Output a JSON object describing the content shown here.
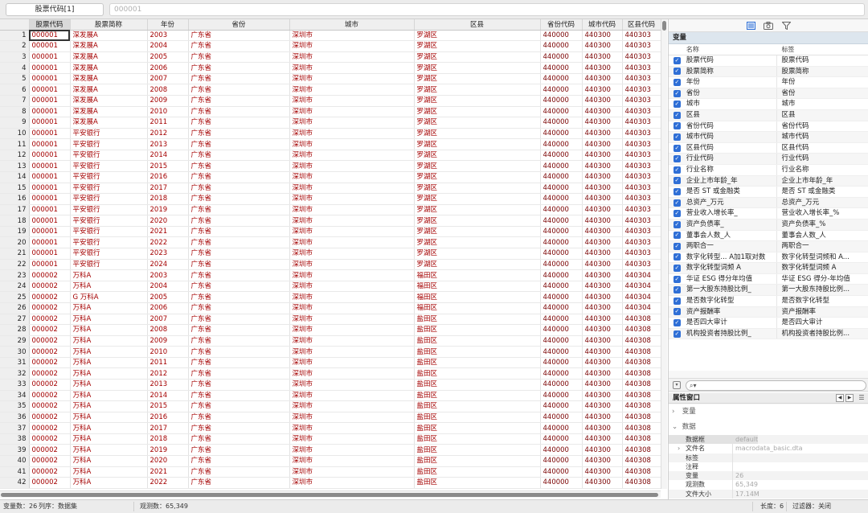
{
  "topbar": {
    "variable_name": "股票代码[1]",
    "cell_value": "000001"
  },
  "grid": {
    "columns": [
      "股票代码",
      "股票简称",
      "年份",
      "省份",
      "城市",
      "区县",
      "省份代码",
      "城市代码",
      "区县代码"
    ],
    "rows": [
      {
        "n": "1",
        "code": "000001",
        "name": "深发展A",
        "year": "2003",
        "prov": "广东省",
        "city": "深圳市",
        "dist": "罗湖区",
        "pc": "440000",
        "cc": "440300",
        "dc": "440303"
      },
      {
        "n": "2",
        "code": "000001",
        "name": "深发展A",
        "year": "2004",
        "prov": "广东省",
        "city": "深圳市",
        "dist": "罗湖区",
        "pc": "440000",
        "cc": "440300",
        "dc": "440303"
      },
      {
        "n": "3",
        "code": "000001",
        "name": "深发展A",
        "year": "2005",
        "prov": "广东省",
        "city": "深圳市",
        "dist": "罗湖区",
        "pc": "440000",
        "cc": "440300",
        "dc": "440303"
      },
      {
        "n": "4",
        "code": "000001",
        "name": "深发展A",
        "year": "2006",
        "prov": "广东省",
        "city": "深圳市",
        "dist": "罗湖区",
        "pc": "440000",
        "cc": "440300",
        "dc": "440303"
      },
      {
        "n": "5",
        "code": "000001",
        "name": "深发展A",
        "year": "2007",
        "prov": "广东省",
        "city": "深圳市",
        "dist": "罗湖区",
        "pc": "440000",
        "cc": "440300",
        "dc": "440303"
      },
      {
        "n": "6",
        "code": "000001",
        "name": "深发展A",
        "year": "2008",
        "prov": "广东省",
        "city": "深圳市",
        "dist": "罗湖区",
        "pc": "440000",
        "cc": "440300",
        "dc": "440303"
      },
      {
        "n": "7",
        "code": "000001",
        "name": "深发展A",
        "year": "2009",
        "prov": "广东省",
        "city": "深圳市",
        "dist": "罗湖区",
        "pc": "440000",
        "cc": "440300",
        "dc": "440303"
      },
      {
        "n": "8",
        "code": "000001",
        "name": "深发展A",
        "year": "2010",
        "prov": "广东省",
        "city": "深圳市",
        "dist": "罗湖区",
        "pc": "440000",
        "cc": "440300",
        "dc": "440303"
      },
      {
        "n": "9",
        "code": "000001",
        "name": "深发展A",
        "year": "2011",
        "prov": "广东省",
        "city": "深圳市",
        "dist": "罗湖区",
        "pc": "440000",
        "cc": "440300",
        "dc": "440303"
      },
      {
        "n": "10",
        "code": "000001",
        "name": "平安银行",
        "year": "2012",
        "prov": "广东省",
        "city": "深圳市",
        "dist": "罗湖区",
        "pc": "440000",
        "cc": "440300",
        "dc": "440303"
      },
      {
        "n": "11",
        "code": "000001",
        "name": "平安银行",
        "year": "2013",
        "prov": "广东省",
        "city": "深圳市",
        "dist": "罗湖区",
        "pc": "440000",
        "cc": "440300",
        "dc": "440303"
      },
      {
        "n": "12",
        "code": "000001",
        "name": "平安银行",
        "year": "2014",
        "prov": "广东省",
        "city": "深圳市",
        "dist": "罗湖区",
        "pc": "440000",
        "cc": "440300",
        "dc": "440303"
      },
      {
        "n": "13",
        "code": "000001",
        "name": "平安银行",
        "year": "2015",
        "prov": "广东省",
        "city": "深圳市",
        "dist": "罗湖区",
        "pc": "440000",
        "cc": "440300",
        "dc": "440303"
      },
      {
        "n": "14",
        "code": "000001",
        "name": "平安银行",
        "year": "2016",
        "prov": "广东省",
        "city": "深圳市",
        "dist": "罗湖区",
        "pc": "440000",
        "cc": "440300",
        "dc": "440303"
      },
      {
        "n": "15",
        "code": "000001",
        "name": "平安银行",
        "year": "2017",
        "prov": "广东省",
        "city": "深圳市",
        "dist": "罗湖区",
        "pc": "440000",
        "cc": "440300",
        "dc": "440303"
      },
      {
        "n": "16",
        "code": "000001",
        "name": "平安银行",
        "year": "2018",
        "prov": "广东省",
        "city": "深圳市",
        "dist": "罗湖区",
        "pc": "440000",
        "cc": "440300",
        "dc": "440303"
      },
      {
        "n": "17",
        "code": "000001",
        "name": "平安银行",
        "year": "2019",
        "prov": "广东省",
        "city": "深圳市",
        "dist": "罗湖区",
        "pc": "440000",
        "cc": "440300",
        "dc": "440303"
      },
      {
        "n": "18",
        "code": "000001",
        "name": "平安银行",
        "year": "2020",
        "prov": "广东省",
        "city": "深圳市",
        "dist": "罗湖区",
        "pc": "440000",
        "cc": "440300",
        "dc": "440303"
      },
      {
        "n": "19",
        "code": "000001",
        "name": "平安银行",
        "year": "2021",
        "prov": "广东省",
        "city": "深圳市",
        "dist": "罗湖区",
        "pc": "440000",
        "cc": "440300",
        "dc": "440303"
      },
      {
        "n": "20",
        "code": "000001",
        "name": "平安银行",
        "year": "2022",
        "prov": "广东省",
        "city": "深圳市",
        "dist": "罗湖区",
        "pc": "440000",
        "cc": "440300",
        "dc": "440303"
      },
      {
        "n": "21",
        "code": "000001",
        "name": "平安银行",
        "year": "2023",
        "prov": "广东省",
        "city": "深圳市",
        "dist": "罗湖区",
        "pc": "440000",
        "cc": "440300",
        "dc": "440303"
      },
      {
        "n": "22",
        "code": "000001",
        "name": "平安银行",
        "year": "2024",
        "prov": "广东省",
        "city": "深圳市",
        "dist": "罗湖区",
        "pc": "440000",
        "cc": "440300",
        "dc": "440303"
      },
      {
        "n": "23",
        "code": "000002",
        "name": "万科A",
        "year": "2003",
        "prov": "广东省",
        "city": "深圳市",
        "dist": "福田区",
        "pc": "440000",
        "cc": "440300",
        "dc": "440304"
      },
      {
        "n": "24",
        "code": "000002",
        "name": "万科A",
        "year": "2004",
        "prov": "广东省",
        "city": "深圳市",
        "dist": "福田区",
        "pc": "440000",
        "cc": "440300",
        "dc": "440304"
      },
      {
        "n": "25",
        "code": "000002",
        "name": "G 万科A",
        "year": "2005",
        "prov": "广东省",
        "city": "深圳市",
        "dist": "福田区",
        "pc": "440000",
        "cc": "440300",
        "dc": "440304"
      },
      {
        "n": "26",
        "code": "000002",
        "name": "万科A",
        "year": "2006",
        "prov": "广东省",
        "city": "深圳市",
        "dist": "福田区",
        "pc": "440000",
        "cc": "440300",
        "dc": "440304"
      },
      {
        "n": "27",
        "code": "000002",
        "name": "万科A",
        "year": "2007",
        "prov": "广东省",
        "city": "深圳市",
        "dist": "盐田区",
        "pc": "440000",
        "cc": "440300",
        "dc": "440308"
      },
      {
        "n": "28",
        "code": "000002",
        "name": "万科A",
        "year": "2008",
        "prov": "广东省",
        "city": "深圳市",
        "dist": "盐田区",
        "pc": "440000",
        "cc": "440300",
        "dc": "440308"
      },
      {
        "n": "29",
        "code": "000002",
        "name": "万科A",
        "year": "2009",
        "prov": "广东省",
        "city": "深圳市",
        "dist": "盐田区",
        "pc": "440000",
        "cc": "440300",
        "dc": "440308"
      },
      {
        "n": "30",
        "code": "000002",
        "name": "万科A",
        "year": "2010",
        "prov": "广东省",
        "city": "深圳市",
        "dist": "盐田区",
        "pc": "440000",
        "cc": "440300",
        "dc": "440308"
      },
      {
        "n": "31",
        "code": "000002",
        "name": "万科A",
        "year": "2011",
        "prov": "广东省",
        "city": "深圳市",
        "dist": "盐田区",
        "pc": "440000",
        "cc": "440300",
        "dc": "440308"
      },
      {
        "n": "32",
        "code": "000002",
        "name": "万科A",
        "year": "2012",
        "prov": "广东省",
        "city": "深圳市",
        "dist": "盐田区",
        "pc": "440000",
        "cc": "440300",
        "dc": "440308"
      },
      {
        "n": "33",
        "code": "000002",
        "name": "万科A",
        "year": "2013",
        "prov": "广东省",
        "city": "深圳市",
        "dist": "盐田区",
        "pc": "440000",
        "cc": "440300",
        "dc": "440308"
      },
      {
        "n": "34",
        "code": "000002",
        "name": "万科A",
        "year": "2014",
        "prov": "广东省",
        "city": "深圳市",
        "dist": "盐田区",
        "pc": "440000",
        "cc": "440300",
        "dc": "440308"
      },
      {
        "n": "35",
        "code": "000002",
        "name": "万科A",
        "year": "2015",
        "prov": "广东省",
        "city": "深圳市",
        "dist": "盐田区",
        "pc": "440000",
        "cc": "440300",
        "dc": "440308"
      },
      {
        "n": "36",
        "code": "000002",
        "name": "万科A",
        "year": "2016",
        "prov": "广东省",
        "city": "深圳市",
        "dist": "盐田区",
        "pc": "440000",
        "cc": "440300",
        "dc": "440308"
      },
      {
        "n": "37",
        "code": "000002",
        "name": "万科A",
        "year": "2017",
        "prov": "广东省",
        "city": "深圳市",
        "dist": "盐田区",
        "pc": "440000",
        "cc": "440300",
        "dc": "440308"
      },
      {
        "n": "38",
        "code": "000002",
        "name": "万科A",
        "year": "2018",
        "prov": "广东省",
        "city": "深圳市",
        "dist": "盐田区",
        "pc": "440000",
        "cc": "440300",
        "dc": "440308"
      },
      {
        "n": "39",
        "code": "000002",
        "name": "万科A",
        "year": "2019",
        "prov": "广东省",
        "city": "深圳市",
        "dist": "盐田区",
        "pc": "440000",
        "cc": "440300",
        "dc": "440308"
      },
      {
        "n": "40",
        "code": "000002",
        "name": "万科A",
        "year": "2020",
        "prov": "广东省",
        "city": "深圳市",
        "dist": "盐田区",
        "pc": "440000",
        "cc": "440300",
        "dc": "440308"
      },
      {
        "n": "41",
        "code": "000002",
        "name": "万科A",
        "year": "2021",
        "prov": "广东省",
        "city": "深圳市",
        "dist": "盐田区",
        "pc": "440000",
        "cc": "440300",
        "dc": "440308"
      },
      {
        "n": "42",
        "code": "000002",
        "name": "万科A",
        "year": "2022",
        "prov": "广东省",
        "city": "深圳市",
        "dist": "盐田区",
        "pc": "440000",
        "cc": "440300",
        "dc": "440308"
      }
    ]
  },
  "toolbar_icons": [
    "variables-icon",
    "snapshot-icon",
    "filter-icon"
  ],
  "variables": {
    "title": "变量",
    "col_name": "名称",
    "col_label": "标签",
    "items": [
      {
        "name": "股票代码",
        "label": "股票代码"
      },
      {
        "name": "股票简称",
        "label": "股票简称"
      },
      {
        "name": "年份",
        "label": "年份"
      },
      {
        "name": "省份",
        "label": "省份"
      },
      {
        "name": "城市",
        "label": "城市"
      },
      {
        "name": "区县",
        "label": "区县"
      },
      {
        "name": "省份代码",
        "label": "省份代码"
      },
      {
        "name": "城市代码",
        "label": "城市代码"
      },
      {
        "name": "区县代码",
        "label": "区县代码"
      },
      {
        "name": "行业代码",
        "label": "行业代码"
      },
      {
        "name": "行业名称",
        "label": "行业名称"
      },
      {
        "name": "企业上市年龄_年",
        "label": "企业上市年龄_年"
      },
      {
        "name": "是否 ST 或金融类",
        "label": "是否 ST 或金融类"
      },
      {
        "name": "总资产_万元",
        "label": "总资产_万元"
      },
      {
        "name": "营业收入增长率_",
        "label": "营业收入增长率_%"
      },
      {
        "name": "资产负债率_",
        "label": "资产负债率_%"
      },
      {
        "name": "董事会人数_人",
        "label": "董事会人数_人"
      },
      {
        "name": "两职合一",
        "label": "两职合一"
      },
      {
        "name": "数字化转型... A加1取对数",
        "label": "数字化转型词频和 A..."
      },
      {
        "name": "数字化转型词频 A",
        "label": "数字化转型词频 A"
      },
      {
        "name": "华证 ESG 得分年均值",
        "label": "华证 ESG 得分-年均值"
      },
      {
        "name": "第一大股东持股比例_",
        "label": "第一大股东持股比例..."
      },
      {
        "name": "是否数字化转型",
        "label": "是否数字化转型"
      },
      {
        "name": "资产报酬率",
        "label": "资产报酬率"
      },
      {
        "name": "是否四大审计",
        "label": "是否四大审计"
      },
      {
        "name": "机构投资者持股比例_",
        "label": "机构投资者持股比例..."
      }
    ]
  },
  "filter": {
    "icon": "search-icon",
    "value": ""
  },
  "properties": {
    "title": "属性窗口",
    "nav_prev": "◀",
    "nav_next": "▶",
    "section_variable": "变量",
    "section_data": "数据",
    "rows": [
      {
        "key": "数据框",
        "value": "default",
        "hl": true,
        "expand": false
      },
      {
        "key": "文件名",
        "value": "macrodata_basic.dta",
        "hl": false,
        "expand": true
      },
      {
        "key": "标签",
        "value": "",
        "hl": false,
        "expand": false
      },
      {
        "key": "注释",
        "value": "",
        "hl": false,
        "expand": false
      },
      {
        "key": "变量",
        "value": "26",
        "hl": false,
        "expand": false
      },
      {
        "key": "观测数",
        "value": "65,349",
        "hl": false,
        "expand": false
      },
      {
        "key": "文件大小",
        "value": "17.14M",
        "hl": false,
        "expand": false
      }
    ]
  },
  "status": {
    "vars": "变量数：26",
    "order": "列序：数据集",
    "obs": "观测数：65,349",
    "length": "长度：6",
    "filter": "过滤器：关闭"
  },
  "colors": {
    "cell_text": "#a40000",
    "checkbox": "#2f6fd6",
    "var_header_bg": "#dde6ee"
  }
}
